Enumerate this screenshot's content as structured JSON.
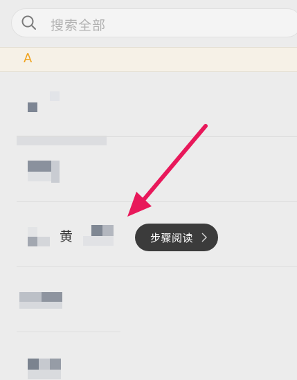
{
  "search": {
    "placeholder": "搜索全部"
  },
  "section": {
    "letter": "A"
  },
  "contacts": [
    {
      "visible_name": ""
    },
    {
      "visible_name": ""
    },
    {
      "visible_name": "黄"
    },
    {
      "visible_name": ""
    },
    {
      "visible_name": ""
    }
  ],
  "steps_button": {
    "label": "步骤阅读"
  },
  "colors": {
    "accent_letter": "#f0a21b",
    "section_bg": "#f6f1e7",
    "pill_bg": "#3b3b3b",
    "arrow": "#e8185a"
  },
  "icons": {
    "search": "search-icon",
    "chevron": "chevron-right-icon",
    "arrow": "pointer-arrow-icon"
  }
}
